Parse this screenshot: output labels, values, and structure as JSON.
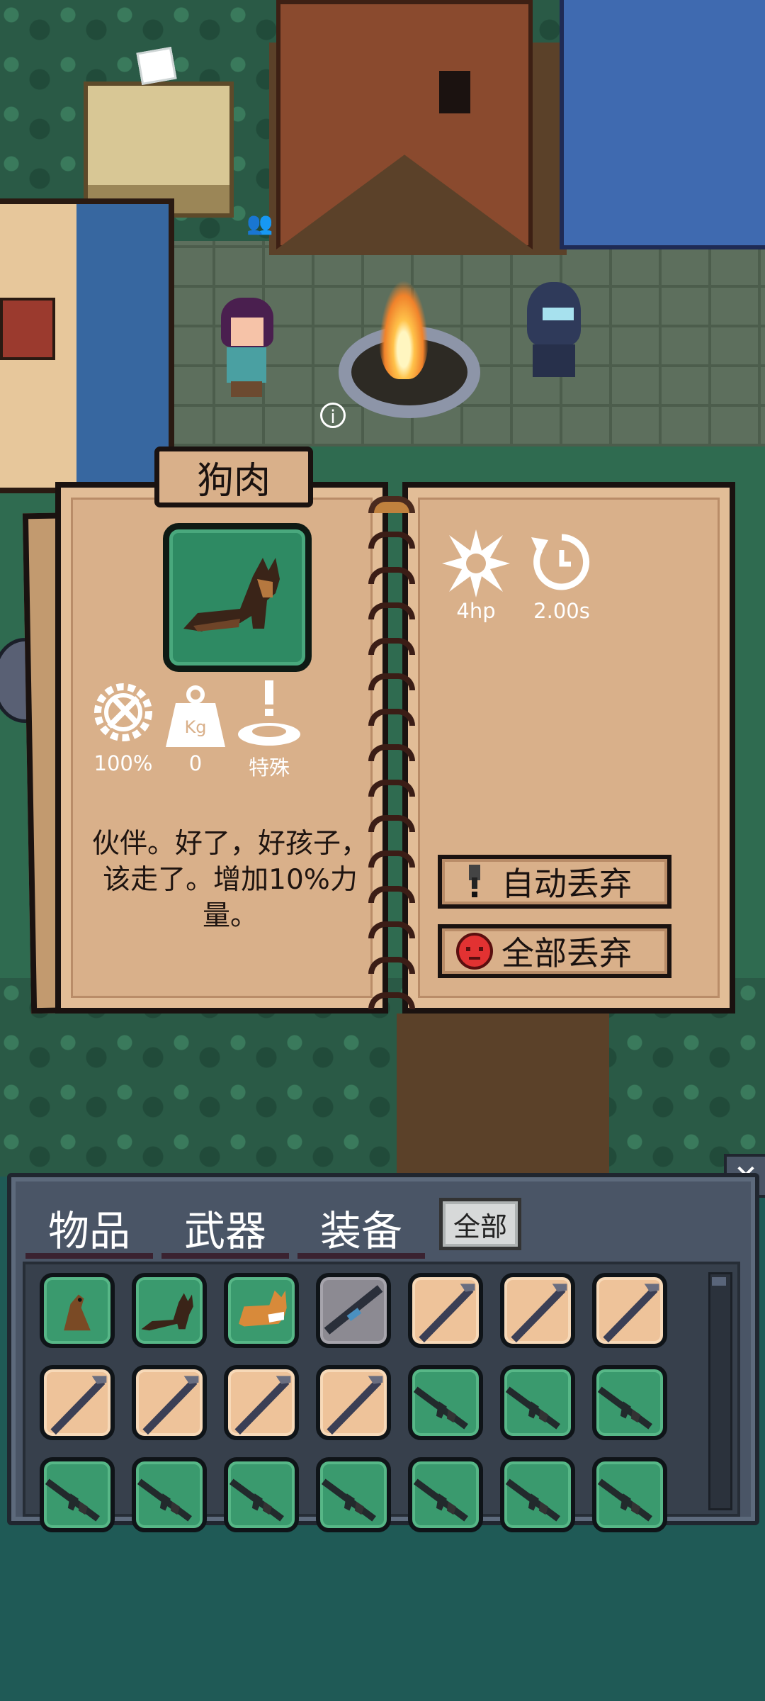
{
  "item_panel": {
    "title": "狗肉",
    "stats_left": [
      {
        "icon": "repair-gear-icon",
        "value": "100%"
      },
      {
        "icon": "weight-kg-icon",
        "value": "0"
      },
      {
        "icon": "special-alert-icon",
        "value": "特殊"
      }
    ],
    "stats_right": [
      {
        "icon": "damage-burst-icon",
        "value": "4hp"
      },
      {
        "icon": "cooldown-timer-icon",
        "value": "2.00s"
      }
    ],
    "description": "伙伴。好了，好孩子，该走了。增加10%力量。",
    "auto_discard_label": "自动丢弃",
    "discard_all_label": "全部丢弃",
    "item_icon": "dog-icon"
  },
  "inventory": {
    "tabs": [
      {
        "label": "物品"
      },
      {
        "label": "武器"
      },
      {
        "label": "装备"
      }
    ],
    "filter_all_label": "全部",
    "close_icon": "close-icon",
    "slots": [
      {
        "type": "green",
        "icon": "weasel-icon"
      },
      {
        "type": "green",
        "icon": "dog-icon"
      },
      {
        "type": "green",
        "icon": "corgi-icon"
      },
      {
        "type": "gray",
        "icon": "rifle-icon"
      },
      {
        "type": "tan",
        "icon": "pipe-icon"
      },
      {
        "type": "tan",
        "icon": "pipe-icon"
      },
      {
        "type": "tan",
        "icon": "pipe-icon"
      },
      {
        "type": "tan",
        "icon": "pipe-icon"
      },
      {
        "type": "tan",
        "icon": "pipe-icon"
      },
      {
        "type": "tan",
        "icon": "pipe-icon"
      },
      {
        "type": "tan",
        "icon": "pipe-icon"
      },
      {
        "type": "green",
        "icon": "assault-rifle-icon"
      },
      {
        "type": "green",
        "icon": "assault-rifle-icon"
      },
      {
        "type": "green",
        "icon": "assault-rifle-icon"
      },
      {
        "type": "green",
        "icon": "assault-rifle-icon"
      },
      {
        "type": "green",
        "icon": "assault-rifle-icon"
      },
      {
        "type": "green",
        "icon": "assault-rifle-icon"
      },
      {
        "type": "green",
        "icon": "assault-rifle-icon"
      },
      {
        "type": "green",
        "icon": "assault-rifle-icon"
      },
      {
        "type": "green",
        "icon": "assault-rifle-icon"
      },
      {
        "type": "green",
        "icon": "assault-rifle-icon"
      }
    ]
  },
  "colors": {
    "panel_parchment": "#d9b08a",
    "slot_green": "#3a9a6e",
    "slot_tan": "#eec39a",
    "inventory_bg": "#4a5566",
    "ocean": "#1f5a56"
  }
}
